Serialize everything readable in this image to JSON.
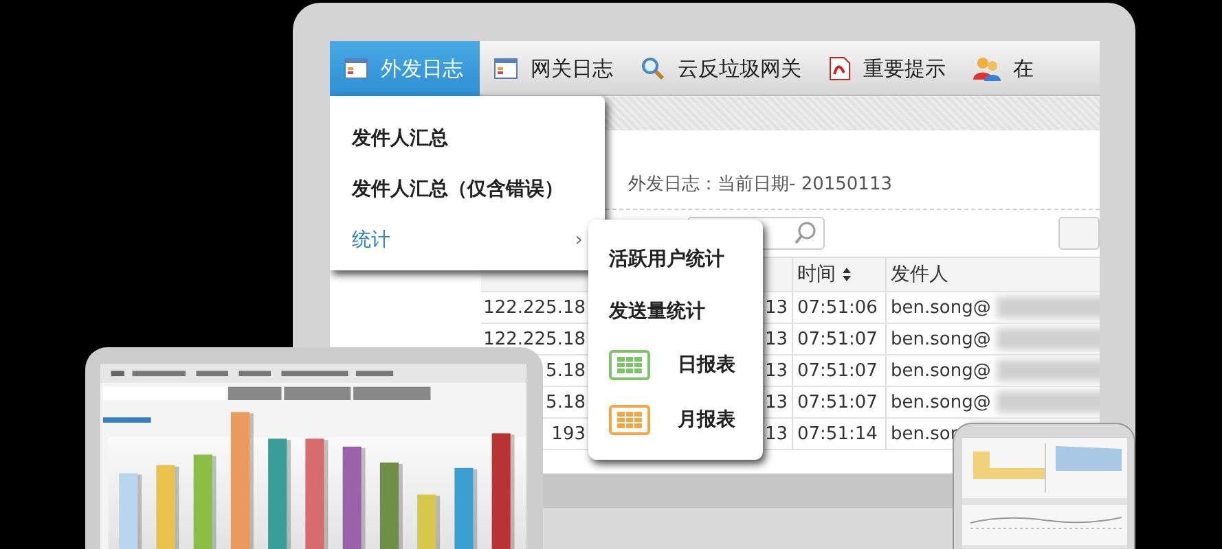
{
  "navbar": {
    "tabs": [
      {
        "label": "外发日志",
        "selected": true,
        "kind": "window"
      },
      {
        "label": "网关日志",
        "selected": false,
        "kind": "window"
      },
      {
        "label": "云反垃圾网关",
        "selected": false,
        "kind": "search"
      },
      {
        "label": "重要提示",
        "selected": false,
        "kind": "document"
      },
      {
        "label": "在",
        "selected": false,
        "kind": "users"
      }
    ]
  },
  "page_title": "外发日志：当前日期- 20150113",
  "table": {
    "columns": [
      {
        "label": "时间",
        "sortable": true
      },
      {
        "label": "发件人",
        "sortable": false
      }
    ],
    "rows": [
      {
        "ip": "122.225.18",
        "date": "13",
        "time": "07:51:06",
        "sender": "ben.song@"
      },
      {
        "ip": "122.225.18",
        "date": "13",
        "time": "07:51:07",
        "sender": "ben.song@"
      },
      {
        "ip": "5.18",
        "date": "13",
        "time": "07:51:07",
        "sender": "ben.song@"
      },
      {
        "ip": "5.18",
        "date": "13",
        "time": "07:51:07",
        "sender": "ben.song@"
      },
      {
        "ip": "193",
        "date": "13",
        "time": "07:51:14",
        "sender": "ben.son"
      }
    ]
  },
  "dropdown": {
    "items": [
      {
        "label": "发件人汇总",
        "selected": false,
        "has_submenu": false
      },
      {
        "label": "发件人汇总（仅含错误）",
        "selected": false,
        "has_submenu": false
      },
      {
        "label": "统计",
        "selected": true,
        "has_submenu": true,
        "arrow": "›"
      }
    ]
  },
  "submenu": {
    "items": [
      {
        "label": "活跃用户统计",
        "kind": "text"
      },
      {
        "label": "发送量统计",
        "kind": "text"
      },
      {
        "label": "日报表",
        "kind": "report",
        "color": "#7cc36a"
      },
      {
        "label": "月报表",
        "kind": "report",
        "color": "#f5a640"
      }
    ]
  }
}
